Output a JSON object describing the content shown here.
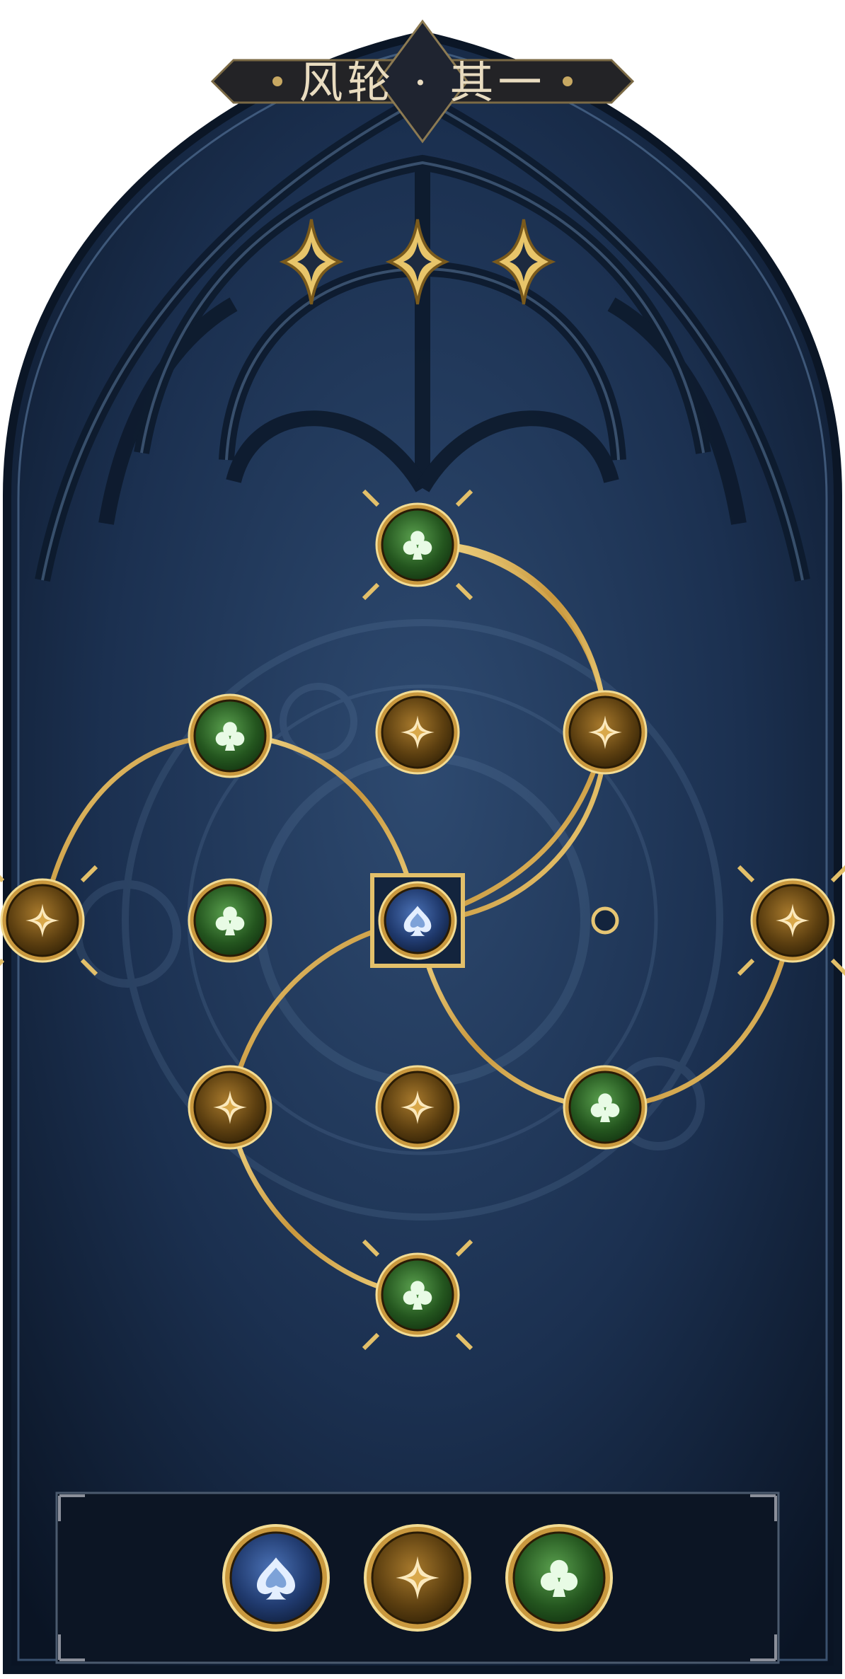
{
  "header": {
    "title": "风轮 · 其一"
  },
  "progress": {
    "total_stars": 3,
    "filled_stars": 3
  },
  "board": {
    "center_node": {
      "kind": "spade",
      "selected": true
    },
    "nodes": [
      {
        "id": "top",
        "kind": "club",
        "endpoint": true
      },
      {
        "id": "top-mid",
        "kind": "diamond",
        "endpoint": false
      },
      {
        "id": "upper-right",
        "kind": "diamond",
        "endpoint": false
      },
      {
        "id": "upper-left",
        "kind": "club",
        "endpoint": false
      },
      {
        "id": "left",
        "kind": "diamond",
        "endpoint": true
      },
      {
        "id": "left-mid",
        "kind": "club",
        "endpoint": false
      },
      {
        "id": "right",
        "kind": "diamond",
        "endpoint": true
      },
      {
        "id": "lower-left",
        "kind": "diamond",
        "endpoint": false
      },
      {
        "id": "bottom-mid",
        "kind": "diamond",
        "endpoint": false
      },
      {
        "id": "lower-right",
        "kind": "club",
        "endpoint": false
      },
      {
        "id": "bottom",
        "kind": "club",
        "endpoint": true
      }
    ],
    "empty_slots": 1
  },
  "legend": {
    "items": [
      {
        "kind": "spade"
      },
      {
        "kind": "diamond"
      },
      {
        "kind": "club"
      }
    ]
  },
  "colors": {
    "gold": "#d9b25a",
    "panel_dark": "#0f1e33",
    "spade_node": "#2c4a86",
    "diamond_node": "#6a4a14",
    "club_node": "#2f6a2a"
  },
  "icons": {
    "spade": "spade-icon",
    "diamond": "four-point-star-icon",
    "club": "club-icon"
  }
}
